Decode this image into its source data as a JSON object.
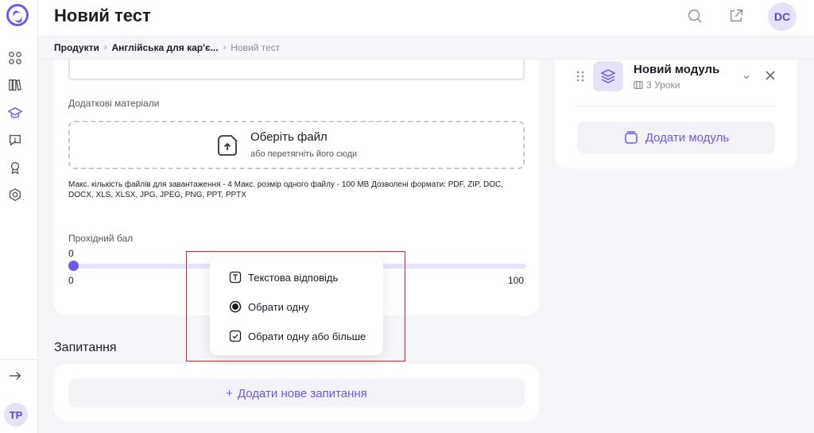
{
  "header": {
    "title": "Новий тест",
    "avatar_initials": "DC",
    "search_icon": "search-icon",
    "external_icon": "external-link-icon"
  },
  "sidebar": {
    "items": [
      {
        "icon": "grid-icon"
      },
      {
        "icon": "library-icon"
      },
      {
        "icon": "graduation-cap-icon",
        "active": true
      },
      {
        "icon": "help-chat-icon"
      },
      {
        "icon": "award-icon"
      },
      {
        "icon": "settings-icon"
      }
    ],
    "expand_icon": "arrow-right-icon",
    "user_initials": "TP"
  },
  "breadcrumb": {
    "items": [
      "Продукти",
      "Англійська для кар'є...",
      "Новий тест"
    ]
  },
  "form": {
    "materials_label": "Додаткові матеріали",
    "dropzone": {
      "title": "Оберіть файл",
      "subtitle": "або перетягніть його сюди",
      "hint": "Макс. кількість файлів для завантаження - 4 Макс. розмір одного файлу - 100 MB Дозволені формати: PDF, ZIP, DOC, DOCX, XLS, XLSX, JPG, JPEG, PNG, PPT, PPTX"
    },
    "passing_score": {
      "label": "Прохідний бал",
      "value": "0",
      "min": "0",
      "max": "100",
      "fraction": 0
    }
  },
  "questions": {
    "title": "Запитання",
    "add_label": "Додати нове запитання"
  },
  "module": {
    "title": "Новий модуль",
    "lessons": "3 Уроки",
    "add_label": "Додати модуль"
  },
  "popup": {
    "options": [
      {
        "label": "Текстова відповідь",
        "icon": "text-icon"
      },
      {
        "label": "Обрати одну",
        "icon": "radio-icon"
      },
      {
        "label": "Обрати одну або більше",
        "icon": "checkbox-icon"
      }
    ]
  },
  "colors": {
    "accent": "#6d5ae6",
    "accent_light": "#e5e2fb",
    "highlight": "#e02020"
  }
}
